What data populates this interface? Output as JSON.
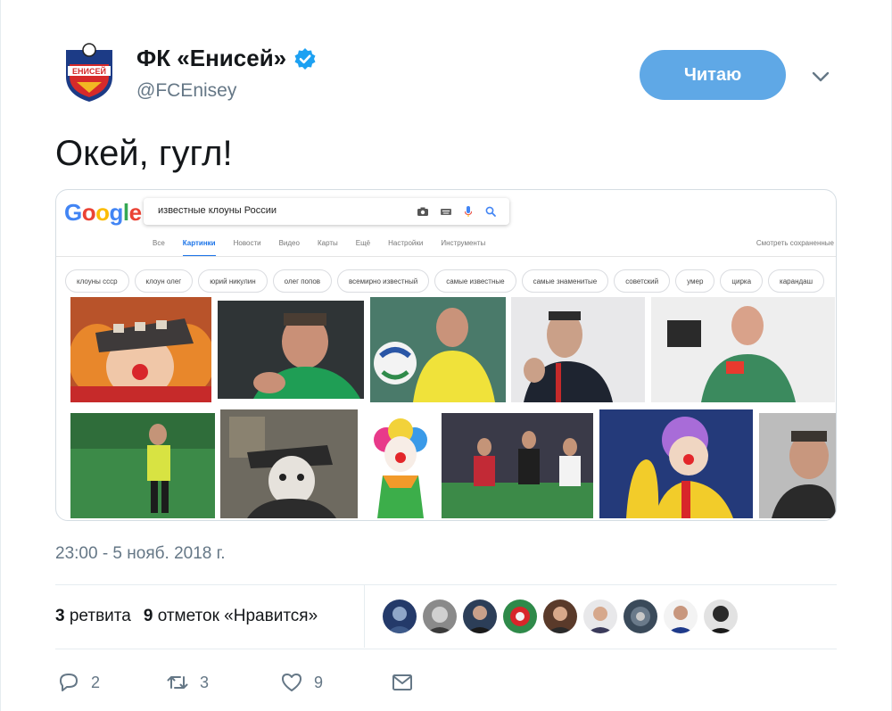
{
  "account": {
    "display_name": "ФК «Енисей»",
    "handle": "@FCEnisey",
    "avatar_label": "ЕНИСЕЙ",
    "follow_label": "Читаю"
  },
  "tweet": {
    "text": "Окей, гугл!",
    "timestamp": "23:00 - 5 нояб. 2018 г."
  },
  "google": {
    "logo": "Google",
    "query": "известные клоуны России",
    "tabs": [
      "Все",
      "Картинки",
      "Новости",
      "Видео",
      "Карты",
      "Ещё",
      "Настройки",
      "Инструменты"
    ],
    "active_tab": "Картинки",
    "saved_label": "Смотреть сохраненные",
    "chips": [
      "клоуны ссср",
      "клоун олег",
      "юрий никулин",
      "олег попов",
      "всемирно известный",
      "самые известные",
      "самые знаменитые",
      "советский",
      "умер",
      "цирка",
      "карандаш"
    ]
  },
  "stats": {
    "retweets_count": "3",
    "retweets_label": "ретвита",
    "likes_count": "9",
    "likes_label": "отметок «Нравится»"
  },
  "actions": {
    "replies": "2",
    "retweets": "3",
    "likes": "9"
  },
  "colors": {
    "accent": "#5fa8e6",
    "verified": "#1da1f2",
    "muted": "#657786"
  }
}
